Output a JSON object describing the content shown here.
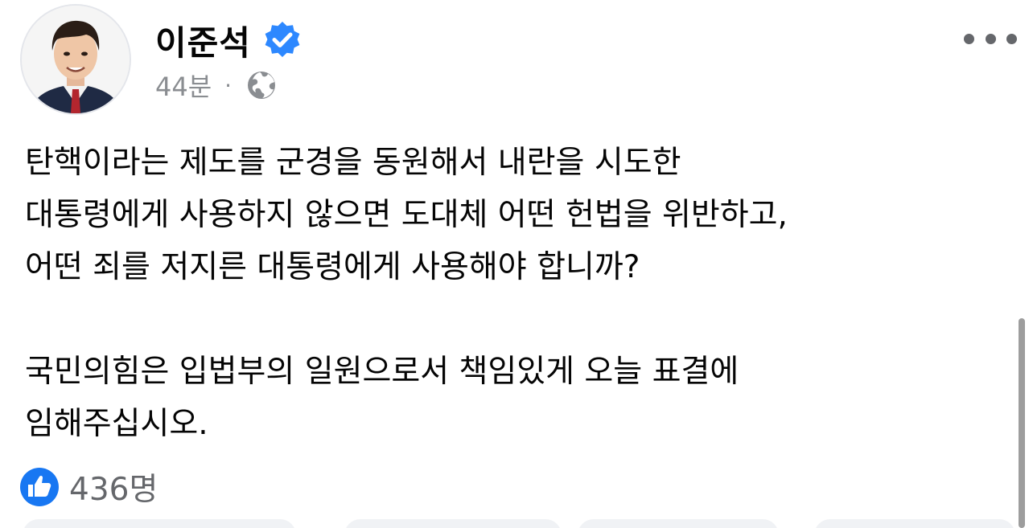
{
  "post": {
    "author_name": "이준석",
    "verified_icon": "verified-badge-icon",
    "time": "44분",
    "separator": "·",
    "audience_icon": "globe-icon",
    "more_icon": "more-options-icon",
    "body_lines": [
      "탄핵이라는 제도를 군경을 동원해서 내란을 시도한",
      "대통령에게 사용하지 않으면 도대체 어떤 헌법을 위반하고,",
      "어떤 죄를 저지른 대통령에게 사용해야 합니까?",
      "",
      "국민의힘은 입법부의 일원으로서 책임있게 오늘 표결에",
      "임해주십시오."
    ],
    "reactions": {
      "icon": "thumbs-up-icon",
      "count_label": "436명"
    }
  },
  "colors": {
    "brand_blue": "#1877f2",
    "verified_blue": "#2d88ff",
    "secondary_text": "#65676b",
    "button_bg": "#f0f2f5"
  }
}
